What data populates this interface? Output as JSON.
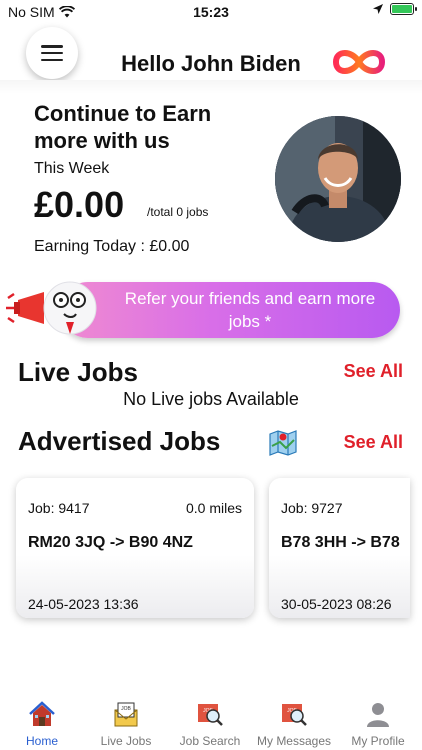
{
  "status_bar": {
    "carrier": "No SIM",
    "time": "15:23"
  },
  "header": {
    "greeting": "Hello John Biden"
  },
  "earnings": {
    "title": "Continue to Earn more with us",
    "period_label": "This Week",
    "amount": "£0.00",
    "total_jobs": "/total 0 jobs",
    "today": "Earning Today : £0.00"
  },
  "refer": {
    "text": "Refer your friends and earn more jobs *"
  },
  "live_jobs": {
    "title": "Live Jobs",
    "see_all": "See All",
    "empty": "No Live jobs Available"
  },
  "advertised_jobs": {
    "title": "Advertised Jobs",
    "see_all": "See All",
    "jobs": [
      {
        "job": "Job: 9417",
        "distance": "0.0 miles",
        "route": "RM20 3JQ -> B90 4NZ",
        "date": "24-05-2023 13:36"
      },
      {
        "job": "Job: 9727",
        "distance": "",
        "route": "B78 3HH -> B78",
        "date": "30-05-2023 08:26"
      }
    ]
  },
  "nav": {
    "items": [
      {
        "label": "Home",
        "icon": "home-icon",
        "active": true
      },
      {
        "label": "Live Jobs",
        "icon": "live-jobs-envelope-icon",
        "active": false
      },
      {
        "label": "Job Search",
        "icon": "job-search-icon",
        "active": false
      },
      {
        "label": "My Messages",
        "icon": "messages-icon",
        "active": false
      },
      {
        "label": "My Profile",
        "icon": "profile-icon",
        "active": false
      }
    ]
  },
  "colors": {
    "accent_red": "#e0202a",
    "banner_start": "#f08bd0",
    "banner_end": "#b85af0",
    "active_nav": "#2a5fd0"
  }
}
